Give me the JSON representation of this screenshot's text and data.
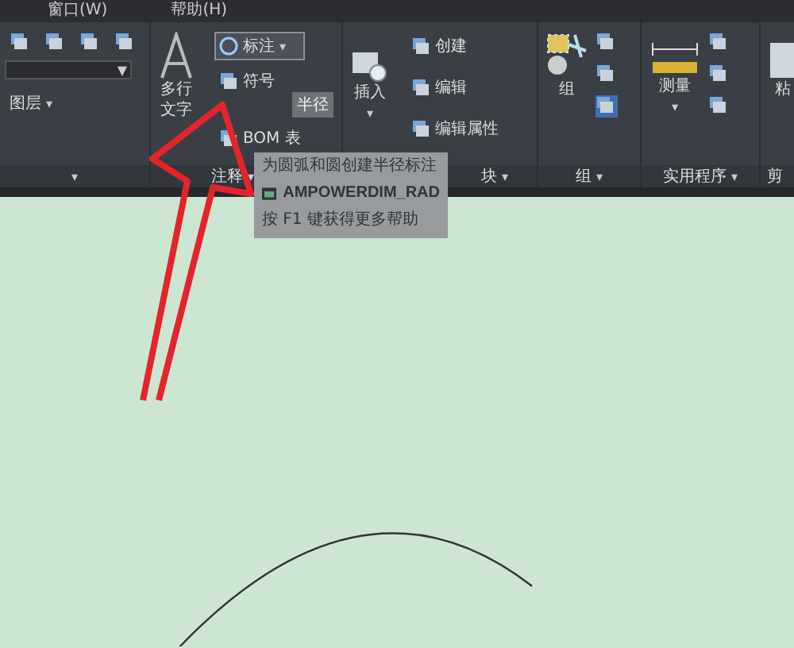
{
  "menu_bar": [
    "窗口(W)",
    "帮助(H)"
  ],
  "ribbon": {
    "layers": {
      "title_caret": "▾",
      "dropdown_arrow": "▼",
      "button": "图层",
      "button_caret": "▾"
    },
    "annotation": {
      "title": "注释",
      "title_caret": "▾",
      "big_button": [
        "多行",
        "文字"
      ],
      "buttons": [
        {
          "label": "标注",
          "caret": "▾",
          "highlighted": true
        },
        {
          "label": "符号",
          "highlighted": false
        },
        {
          "label": "BOM 表",
          "highlighted": false
        }
      ]
    },
    "block": {
      "title": "块",
      "title_caret": "▾",
      "big_button": "插入",
      "big_caret": "▾",
      "buttons": [
        "创建",
        "编辑",
        "编辑属性"
      ]
    },
    "group": {
      "title": "组",
      "title_caret": "▾",
      "big_button": "组"
    },
    "utilities": {
      "title": "实用程序",
      "title_caret": "▾",
      "big_button": "测量",
      "big_caret": "▾"
    },
    "clipboard": {
      "title": "剪",
      "big_button": "粘"
    }
  },
  "tooltip": {
    "flyout_label": "半径",
    "description": "为圆弧和圆创建半径标注",
    "command": "AMPOWERDIM_RAD",
    "help": "按 F1 键获得更多帮助"
  }
}
